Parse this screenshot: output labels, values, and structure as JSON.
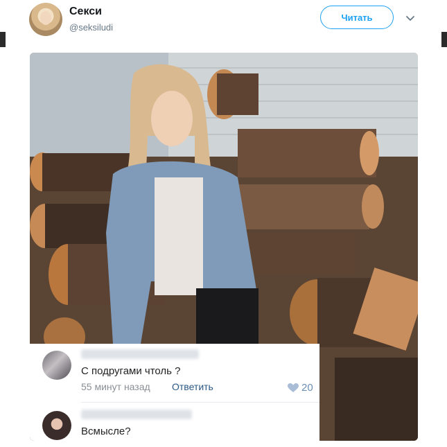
{
  "tweet": {
    "display_name": "Секси",
    "handle": "@seksiludi",
    "follow_label": "Читать"
  },
  "comments": [
    {
      "text": "С подругами чтоль ?",
      "time": "55 минут назад",
      "reply_label": "Ответить",
      "likes": "20"
    },
    {
      "text": "Всмысле?"
    }
  ],
  "colors": {
    "accent": "#1da1f2",
    "reply_link": "#2a5885",
    "like": "#6b8fb5"
  }
}
